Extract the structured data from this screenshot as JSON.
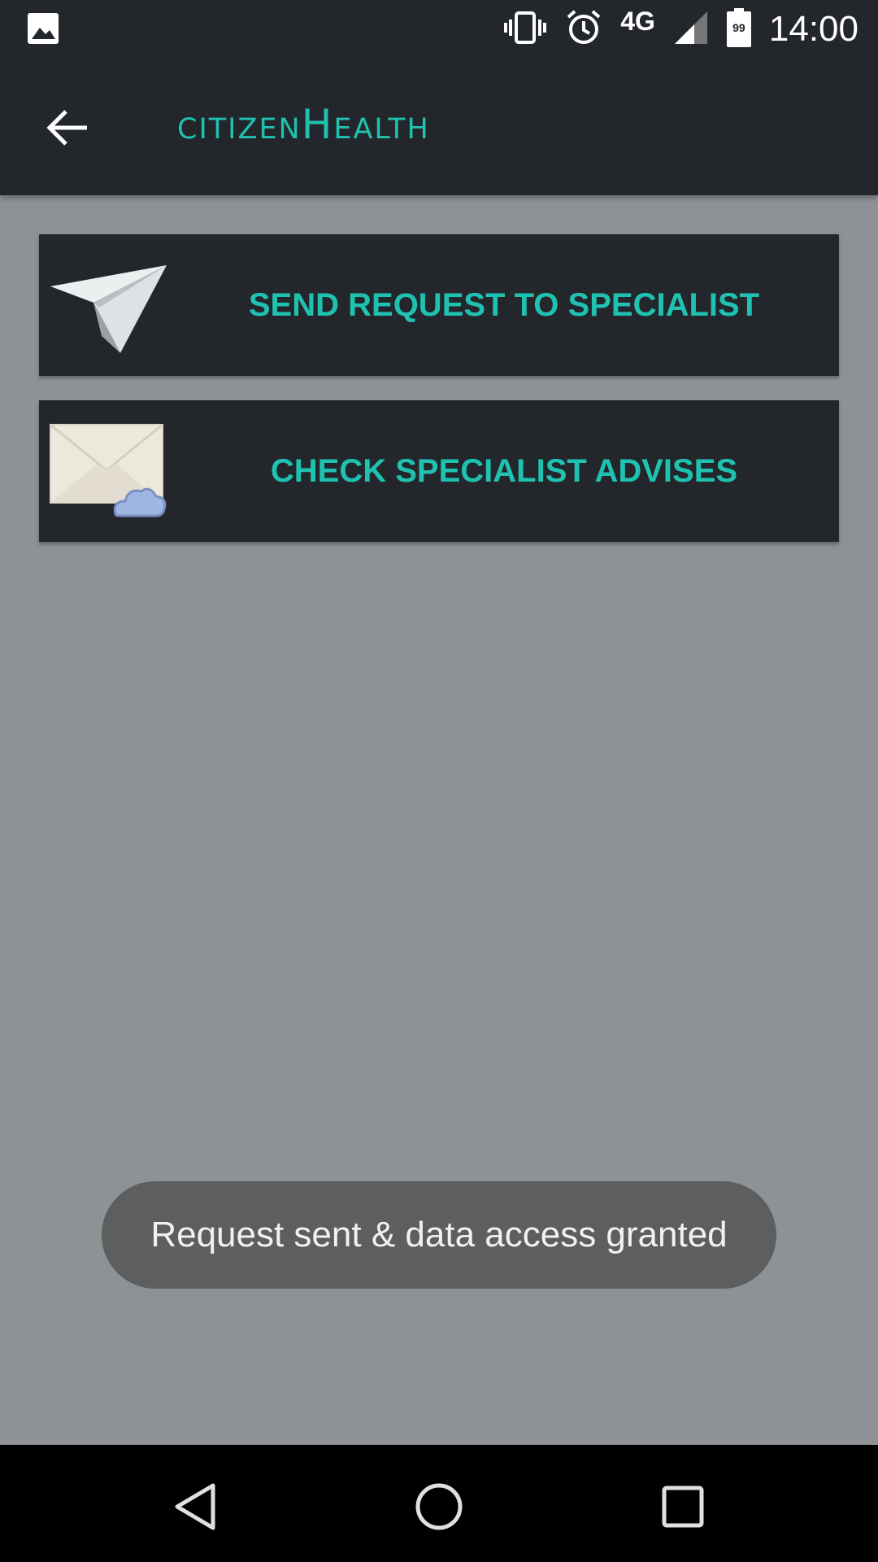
{
  "status_bar": {
    "time": "14:00",
    "network": "4G",
    "battery_level": "99",
    "icons": [
      "image-icon",
      "vibrate-icon",
      "alarm-icon",
      "signal-icon",
      "battery-icon"
    ]
  },
  "app_bar": {
    "title_prefix": "citizen",
    "title_cap": "H",
    "title_rest": "ealth",
    "back_icon": "arrow-back-icon"
  },
  "actions": {
    "send_label": "SEND REQUEST TO SPECIALIST",
    "send_icon": "paper-plane-icon",
    "check_label": "CHECK SPECIALIST ADVISES",
    "check_icon": "envelope-cloud-icon"
  },
  "toast": {
    "message": "Request sent & data access granted"
  },
  "nav_bar": {
    "icons": [
      "nav-back-icon",
      "nav-home-icon",
      "nav-recents-icon"
    ]
  },
  "colors": {
    "accent": "#1fc2b1",
    "bar": "#23262b",
    "background": "#8e9196",
    "toast": "#5d5e5e"
  }
}
